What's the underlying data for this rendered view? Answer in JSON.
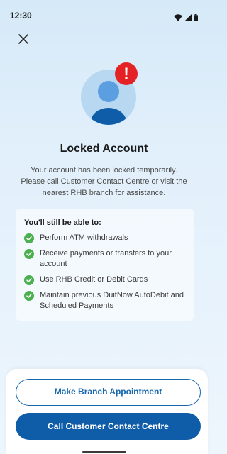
{
  "status_bar": {
    "time": "12:30",
    "icons": [
      "wifi-icon",
      "signal-icon",
      "battery-icon"
    ]
  },
  "header": {
    "close_icon": "close-icon"
  },
  "hero": {
    "icon": "user-avatar-icon",
    "badge_text": "!",
    "badge_color": "#e42226"
  },
  "main": {
    "title": "Locked Account",
    "description": "Your account has been locked temporarily. Please call Customer Contact Centre or visit the nearest RHB branch for assistance."
  },
  "info_card": {
    "heading": "You'll still be able to:",
    "items": [
      {
        "label": "Perform ATM withdrawals"
      },
      {
        "label": "Receive payments or transfers to your account"
      },
      {
        "label": "Use RHB Credit or Debit Cards"
      },
      {
        "label": "Maintain previous DuitNow AutoDebit and Scheduled Payments"
      }
    ],
    "check_color": "#4caf50"
  },
  "actions": {
    "appointment_label": "Make Branch Appointment",
    "call_label": "Call Customer Contact Centre",
    "primary_color": "#0f5ca8"
  }
}
